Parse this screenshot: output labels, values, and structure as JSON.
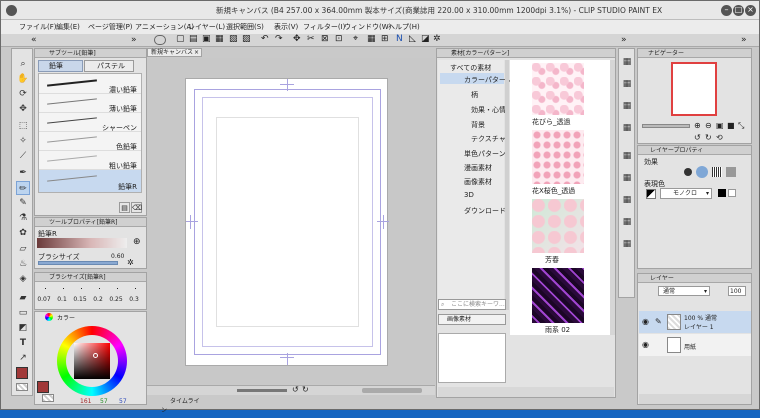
{
  "window_title": "新規キャンバス (B4 257.00 x 364.00mm 製本サイズ(商業誌用 220.00 x 310.00mm 1200dpi 3.1%) - CLIP STUDIO PAINT EX",
  "menu": [
    "ファイル(F)",
    "編集(E)",
    "ページ管理(P)",
    "アニメーション(A)",
    "レイヤー(L)",
    "選択範囲(S)",
    "表示(V)",
    "フィルター(I)",
    "ウィンドウ(W)",
    "ヘルプ(H)"
  ],
  "sub_tool": {
    "panel_title": "サブツール[鉛筆]",
    "tabs": [
      "鉛筆",
      "パステル"
    ],
    "items": [
      "濃い鉛筆",
      "薄い鉛筆",
      "シャーペン",
      "色鉛筆",
      "粗い鉛筆",
      "鉛筆R"
    ]
  },
  "tool_property": {
    "panel_title": "ツールプロパティ[鉛筆R]",
    "tool_name": "鉛筆R",
    "brush_size_label": "ブラシサイズ",
    "brush_size_value": "0.60"
  },
  "brush_size_panel": {
    "title": "ブラシサイズ[鉛筆R]",
    "sizes": [
      "0.07",
      "0.1",
      "0.15",
      "0.2",
      "0.25",
      "0.3"
    ]
  },
  "color_panel": {
    "tab": "カラー",
    "r": "161",
    "g": "57",
    "b": "57"
  },
  "canvas_tab": "新規キャンバス",
  "timeline_tab": "タイムライン",
  "material": {
    "panel_title": "素材[カラーパターン]",
    "tree": [
      "すべての素材",
      "カラーパターン",
      "柄",
      "効果・心情",
      "背景",
      "テクスチャ",
      "単色パターン",
      "漫画素材",
      "画像素材",
      "3D",
      "ダウンロード"
    ],
    "items": [
      "花びら_透過",
      "花X桜色_透過",
      "芳春",
      "雨系 02"
    ],
    "search_placeholder": "ここに検索キーワ...",
    "category_button": "画像素材"
  },
  "navigator": {
    "tab": "ナビゲーター"
  },
  "layer_property": {
    "tab": "レイヤープロパティ",
    "effect_label": "効果",
    "express_color_label": "表現色",
    "express_color_value": "モノクロ"
  },
  "layer_panel": {
    "tab": "レイヤー",
    "blend": "通常",
    "opacity": "100",
    "layers": [
      {
        "line1": "100 %  通常",
        "line2": "レイヤー 1"
      },
      {
        "line1": "",
        "line2": "用紙"
      }
    ]
  },
  "colors": {
    "accent": "#d63a3a",
    "window_bg": "#c9c9c9",
    "desktop": "#1565c0",
    "current_color": "#a13939"
  }
}
